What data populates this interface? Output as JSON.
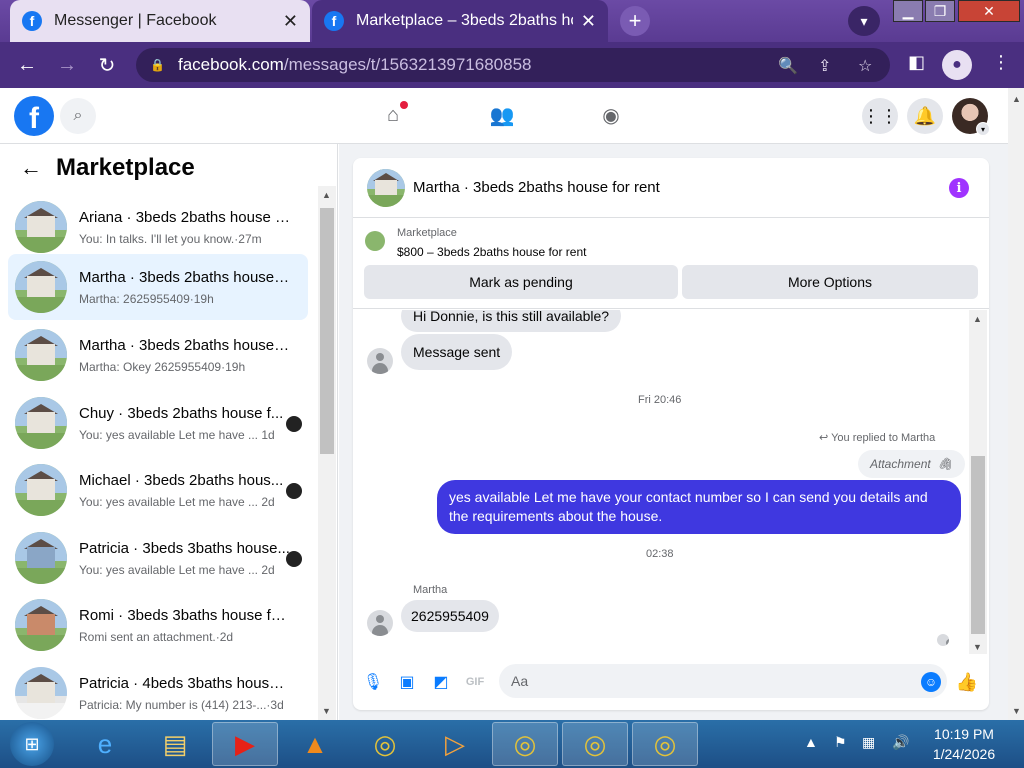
{
  "browser": {
    "tabs": [
      {
        "title": "Messenger | Facebook",
        "favicon": "facebook-icon",
        "active": false
      },
      {
        "title": "Marketplace – 3beds 2baths hous",
        "favicon": "facebook-icon",
        "active": true
      }
    ],
    "url_domain": "facebook.com",
    "url_path": "/messages/t/1563213971680858"
  },
  "fb": {
    "logo": "f",
    "icons": [
      "search-icon",
      "home-icon",
      "friends-icon",
      "groups-icon",
      "menu-grid-icon",
      "bell-icon"
    ]
  },
  "left": {
    "title": "Marketplace",
    "conversations": [
      {
        "name": "Ariana · 3beds 2baths house fo...",
        "sub": "You: In talks. I'll let you know.·27m",
        "thumb": "",
        "mini": false
      },
      {
        "name": "Martha · 3beds 2baths house f...",
        "sub": "Martha: 2625955409·19h",
        "thumb": "",
        "mini": false,
        "selected": true
      },
      {
        "name": "Martha · 3beds 2baths house f...",
        "sub": "Martha: Okey 2625955409·19h",
        "thumb": "",
        "mini": false
      },
      {
        "name": "Chuy · 3beds 2baths house f...",
        "sub": "You: yes available Let me have ...  1d",
        "thumb": "",
        "mini": true
      },
      {
        "name": "Michael · 3beds 2baths hous...",
        "sub": "You: yes available Let me have ...  2d",
        "thumb": "",
        "mini": true
      },
      {
        "name": "Patricia · 3beds 3baths house...",
        "sub": "You: yes available Let me have ...  2d",
        "thumb": "blue",
        "mini": true
      },
      {
        "name": "Romi · 3beds 3baths house for ...",
        "sub": "Romi sent an attachment.·2d",
        "thumb": "brick",
        "mini": false
      },
      {
        "name": "Patricia · 4beds 3baths house f...",
        "sub": "Patricia: My number is (414) 213-...·3d",
        "thumb": "snow",
        "mini": false
      }
    ]
  },
  "chat": {
    "title": "Martha · 3beds 2baths house for rent",
    "marketplace_label": "Marketplace",
    "listing": "$800 – 3beds 2baths house for rent",
    "mark_pending": "Mark as pending",
    "more_options": "More Options",
    "msg_partial": "Hi Donnie, is this still available?",
    "msg_sent": "Message sent",
    "ts1": "Fri 20:46",
    "reply_note": "You replied to Martha",
    "attachment": "Attachment",
    "my_msg": "yes available Let me have your contact number so I can send you details and the requirements about the house.",
    "ts2": "02:38",
    "sender": "Martha",
    "their_msg": "2625955409",
    "composer_placeholder": "Aa"
  },
  "taskbar": {
    "time": "10:19 PM",
    "date": "1/24/2026"
  }
}
